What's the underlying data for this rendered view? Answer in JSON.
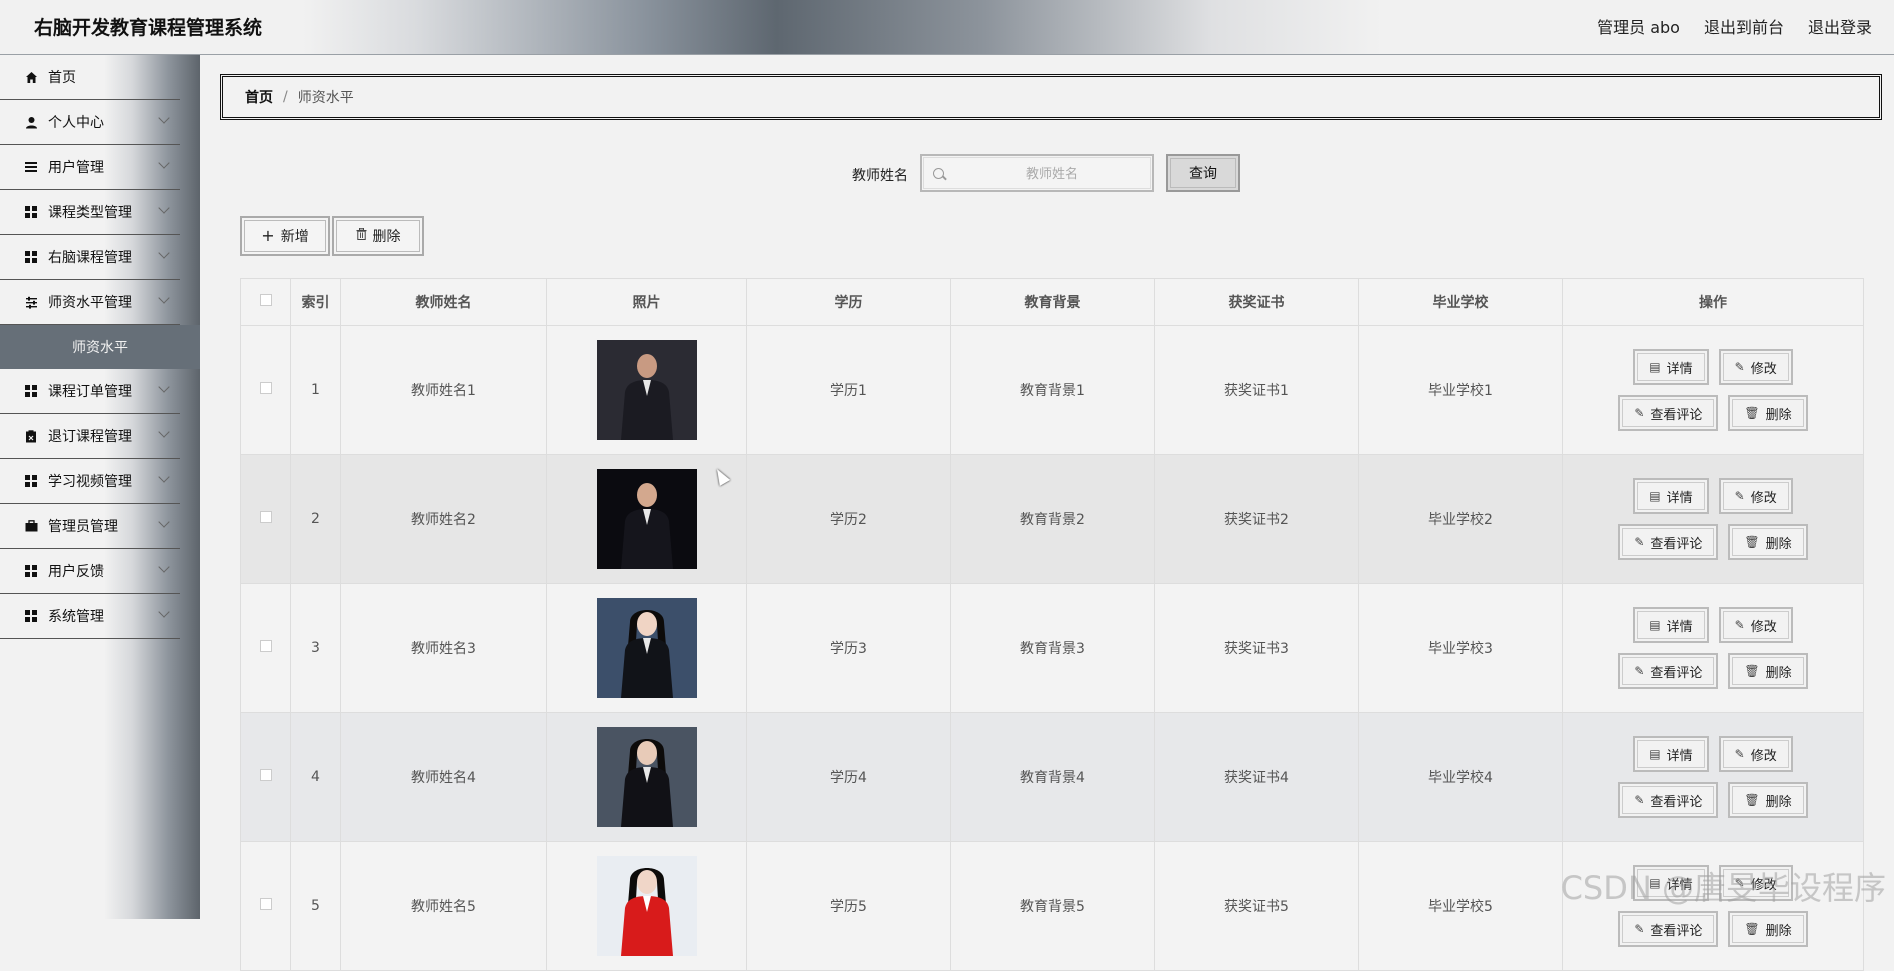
{
  "header": {
    "app_title": "右脑开发教育课程管理系统",
    "admin_label": "管理员 abo",
    "front_label": "退出到前台",
    "logout_label": "退出登录"
  },
  "sidebar": {
    "items": [
      {
        "label": "首页",
        "icon": "home-icon"
      },
      {
        "label": "个人中心",
        "icon": "user-icon"
      },
      {
        "label": "用户管理",
        "icon": "list-icon"
      },
      {
        "label": "课程类型管理",
        "icon": "grid-icon"
      },
      {
        "label": "右脑课程管理",
        "icon": "grid-icon"
      },
      {
        "label": "师资水平管理",
        "icon": "sliders-icon"
      },
      {
        "label": "师资水平",
        "icon": ""
      },
      {
        "label": "课程订单管理",
        "icon": "grid-icon"
      },
      {
        "label": "退订课程管理",
        "icon": "clipboard-icon"
      },
      {
        "label": "学习视频管理",
        "icon": "grid-icon"
      },
      {
        "label": "管理员管理",
        "icon": "briefcase-icon"
      },
      {
        "label": "用户反馈",
        "icon": "grid-icon"
      },
      {
        "label": "系统管理",
        "icon": "grid-icon"
      }
    ]
  },
  "breadcrumb": {
    "home": "首页",
    "separator": "/",
    "current": "师资水平"
  },
  "search": {
    "label": "教师姓名",
    "placeholder": "教师姓名",
    "value": "",
    "button_label": "查询"
  },
  "actions": {
    "add_label": "新增",
    "delete_label": "删除"
  },
  "table": {
    "columns": [
      "",
      "索引",
      "教师姓名",
      "照片",
      "学历",
      "教育背景",
      "获奖证书",
      "毕业学校",
      "操作"
    ],
    "row_ops": {
      "detail": "详情",
      "edit": "修改",
      "comments": "查看评论",
      "delete": "删除"
    },
    "rows": [
      {
        "index": "1",
        "name": "教师姓名1",
        "education": "学历1",
        "background": "教育背景1",
        "certificate": "获奖证书1",
        "school": "毕业学校1"
      },
      {
        "index": "2",
        "name": "教师姓名2",
        "education": "学历2",
        "background": "教育背景2",
        "certificate": "获奖证书2",
        "school": "毕业学校2"
      },
      {
        "index": "3",
        "name": "教师姓名3",
        "education": "学历3",
        "background": "教育背景3",
        "certificate": "获奖证书3",
        "school": "毕业学校3"
      },
      {
        "index": "4",
        "name": "教师姓名4",
        "education": "学历4",
        "background": "教育背景4",
        "certificate": "获奖证书4",
        "school": "毕业学校4"
      },
      {
        "index": "5",
        "name": "教师姓名5",
        "education": "学历5",
        "background": "教育背景5",
        "certificate": "获奖证书5",
        "school": "毕业学校5"
      }
    ]
  },
  "watermark": "CSDN @唐旻毕设程序",
  "colors": {
    "active_submenu_bg": "#666f78",
    "page_bg": "#f2f2f2"
  }
}
